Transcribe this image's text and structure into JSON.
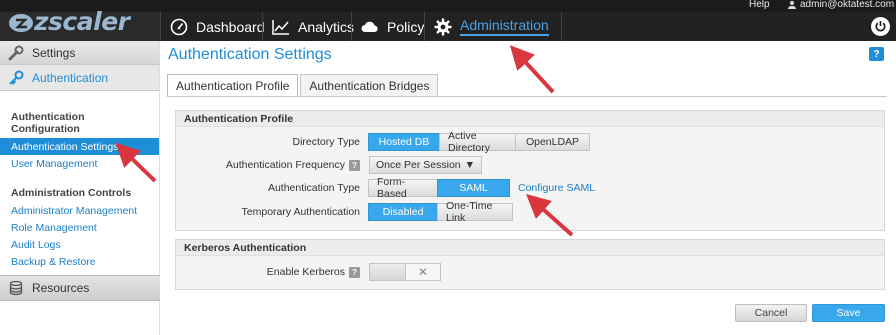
{
  "topbar": {
    "help": "Help",
    "user": "admin@oktatest.com"
  },
  "logo": {
    "text": "zscaler"
  },
  "nav": {
    "items": [
      {
        "label": "Dashboard",
        "icon": "gauge-icon"
      },
      {
        "label": "Analytics",
        "icon": "line-chart-icon"
      },
      {
        "label": "Policy",
        "icon": "cloud-icon"
      },
      {
        "label": "Administration",
        "icon": "gear-icon",
        "active": true
      }
    ]
  },
  "sidebar": {
    "settings": "Settings",
    "authentication": "Authentication",
    "auth_config_title": "Authentication Configuration",
    "auth_settings": "Authentication Settings",
    "user_management": "User Management",
    "admin_controls_title": "Administration Controls",
    "admin_management": "Administrator Management",
    "role_management": "Role Management",
    "audit_logs": "Audit Logs",
    "backup_restore": "Backup & Restore",
    "resources": "Resources"
  },
  "main": {
    "title": "Authentication Settings",
    "help_badge": "?",
    "tabs": [
      "Authentication Profile",
      "Authentication Bridges"
    ],
    "profile": {
      "heading": "Authentication Profile",
      "directory_type_label": "Directory Type",
      "directory_types": [
        "Hosted DB",
        "Active Directory",
        "OpenLDAP"
      ],
      "directory_selected": "Hosted DB",
      "frequency_label": "Authentication Frequency",
      "frequency_value": "Once Per Session",
      "auth_type_label": "Authentication Type",
      "auth_types": [
        "Form-Based",
        "SAML"
      ],
      "auth_type_selected": "SAML",
      "configure_saml": "Configure SAML",
      "temp_auth_label": "Temporary Authentication",
      "temp_auth_options": [
        "Disabled",
        "One-Time Link"
      ],
      "temp_auth_selected": "Disabled"
    },
    "kerberos": {
      "heading": "Kerberos Authentication",
      "enable_label": "Enable Kerberos",
      "enabled": false
    },
    "buttons": {
      "cancel": "Cancel",
      "save": "Save"
    }
  },
  "colors": {
    "accent": "#1f8ed8",
    "annotation_arrow": "#d9363e",
    "nav_bg": "#222222"
  }
}
